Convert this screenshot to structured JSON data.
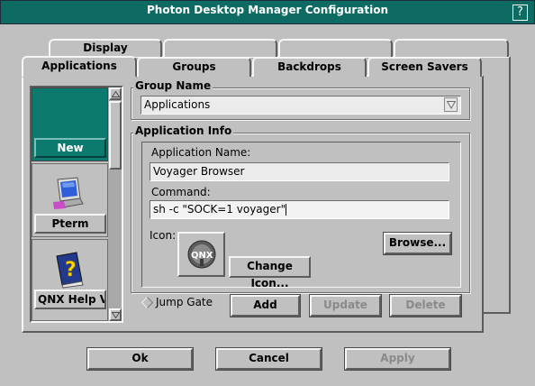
{
  "window": {
    "title": "Photon Desktop Manager Configuration",
    "help_glyph": "?"
  },
  "tabs_back": [
    {
      "label": "Display"
    },
    {
      "label": ""
    },
    {
      "label": ""
    },
    {
      "label": ""
    }
  ],
  "tabs_front": [
    {
      "label": "Applications",
      "selected": true
    },
    {
      "label": "Groups"
    },
    {
      "label": "Backdrops"
    },
    {
      "label": "Screen Savers"
    }
  ],
  "app_list": {
    "items": [
      {
        "label": "New",
        "icon": "blank-teal-icon"
      },
      {
        "label": "Pterm",
        "icon": "terminal-monitor-icon"
      },
      {
        "label": "QNX Help Vie",
        "icon": "help-book-icon"
      }
    ]
  },
  "group_name": {
    "label": "Group Name",
    "value": "Applications"
  },
  "app_info": {
    "label": "Application Info",
    "name_label": "Application Name:",
    "name_value": "Voyager Browser",
    "command_label": "Command:",
    "command_value": "sh -c \"SOCK=1 voyager\"",
    "icon_label": "Icon:",
    "browse_label": "Browse...",
    "change_icon_label": "Change Icon...",
    "current_icon": "qnx-logo-icon"
  },
  "jump_gate": {
    "label": "Jump Gate",
    "checked": false
  },
  "actions": {
    "add": "Add",
    "update": "Update",
    "delete": "Delete"
  },
  "footer": {
    "ok": "Ok",
    "cancel": "Cancel",
    "apply": "Apply"
  },
  "colors": {
    "titlebar": "#0d6b63",
    "selected_item": "#0d7a70",
    "background": "#c0c0c0"
  }
}
